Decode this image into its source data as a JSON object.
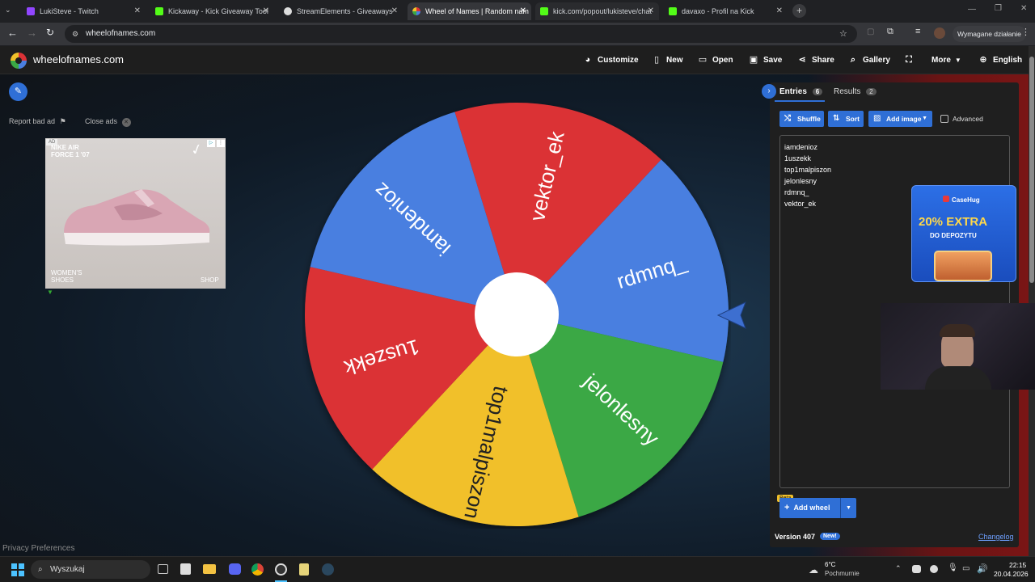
{
  "browser": {
    "tabs": [
      {
        "label": "LukiSteve - Twitch",
        "color": "#9146ff"
      },
      {
        "label": "Kickaway - Kick Giveaway Tool",
        "color": "#53fc18"
      },
      {
        "label": "StreamElements - Giveaways",
        "color": "#ffffff"
      },
      {
        "label": "Wheel of Names | Random nam",
        "color": "#e84a3a"
      },
      {
        "label": "kick.com/popout/lukisteve/chat",
        "color": "#53fc18"
      },
      {
        "label": "davaxo - Profil na Kick",
        "color": "#53fc18"
      }
    ],
    "url": "wheelofnames.com",
    "action_required": "Wymagane działanie"
  },
  "site": {
    "brand": "wheelofnames.com",
    "nav": {
      "customize": "Customize",
      "new": "New",
      "open": "Open",
      "save": "Save",
      "share": "Share",
      "gallery": "Gallery",
      "more": "More",
      "language": "English"
    }
  },
  "ads": {
    "report": "Report bad ad",
    "close": "Close ads",
    "ad_badge": "AD",
    "product_line1": "NIKE AIR",
    "product_line2": "FORCE 1 '07",
    "category_line1": "WOMEN'S",
    "category_line2": "SHOES",
    "cta": "SHOP",
    "privacy": "Privacy Preferences"
  },
  "wheel": {
    "segments": [
      {
        "label": "vektor_ek",
        "color": "#db3236"
      },
      {
        "label": "rdmnq_",
        "color": "#4a7fe0"
      },
      {
        "label": "jelonlesny",
        "color": "#3aa845"
      },
      {
        "label": "top1malpiszon",
        "color": "#f1c02a"
      },
      {
        "label": "1uszekk",
        "color": "#db3236"
      },
      {
        "label": "iamdenioz",
        "color": "#4a7fe0"
      }
    ]
  },
  "panel": {
    "entries_tab": "Entries",
    "entries_count": "6",
    "results_tab": "Results",
    "results_count": "2",
    "shuffle": "Shuffle",
    "sort": "Sort",
    "add_image": "Add image",
    "advanced": "Advanced",
    "entries": [
      "iamdenioz",
      "1uszekk",
      "top1malpiszon",
      "jelonlesny",
      "rdmnq_",
      "vektor_ek"
    ],
    "beta": "Beta",
    "add_wheel": "Add wheel",
    "version": "Version 407",
    "new_badge": "New!",
    "changelog": "Changelog"
  },
  "promo": {
    "brand": "CaseHug",
    "headline": "20% EXTRA",
    "sub": "DO DEPOZYTU"
  },
  "taskbar": {
    "search": "Wyszukaj",
    "weather_temp": "6°C",
    "weather_desc": "Pochmurnie",
    "time": "22:15",
    "date": "20.04.2026"
  }
}
